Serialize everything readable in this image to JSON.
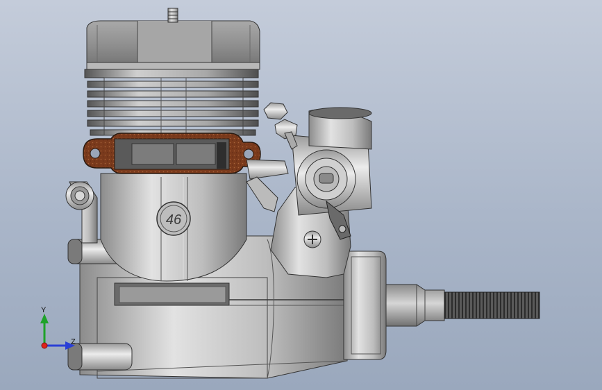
{
  "engine": {
    "displacement_marking": "46"
  },
  "triad": {
    "y_label": "Y",
    "z_label": "Z",
    "y_axis_color": "#1fa22a",
    "z_axis_color": "#2a3fd6",
    "x_axis_color": "#e0231b"
  },
  "colors": {
    "background_top": "#c4ccda",
    "background_bottom": "#9aa8bd",
    "gasket": "#7a3a1c",
    "metal_light": "#dcdcdc",
    "metal_dark": "#6e6e6e"
  }
}
